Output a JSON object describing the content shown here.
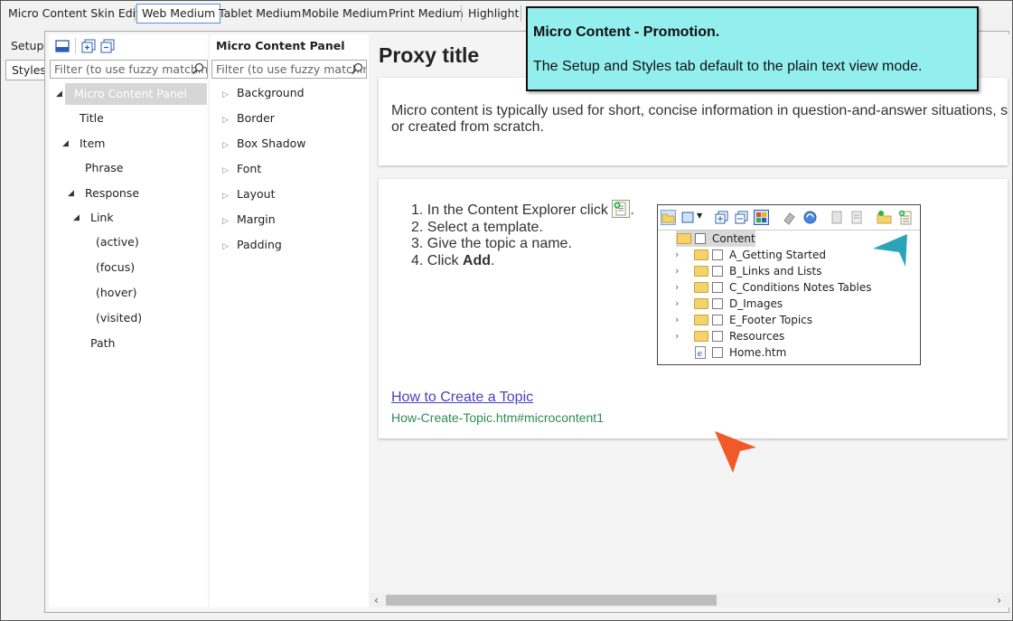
{
  "tabs": {
    "editor": "Micro Content Skin Editor",
    "web_medium": "Web Medium",
    "tablet_medium": "Tablet Medium",
    "mobile_medium": "Mobile Medium",
    "print_medium": "Print Medium",
    "highlight": "Highlight"
  },
  "side_tabs": {
    "setup": "Setup",
    "styles": "Styles"
  },
  "filter_placeholder": "Filter (to use fuzzy matching",
  "tree": {
    "root": "Micro Content Panel",
    "title": "Title",
    "item": "Item",
    "phrase": "Phrase",
    "response": "Response",
    "link": "Link",
    "active": "(active)",
    "focus": "(focus)",
    "hover": "(hover)",
    "visited": "(visited)",
    "path": "Path"
  },
  "properties": {
    "heading": "Micro Content Panel",
    "items": [
      "Background",
      "Border",
      "Box Shadow",
      "Font",
      "Layout",
      "Margin",
      "Padding"
    ]
  },
  "preview": {
    "proxy_title": "Proxy title",
    "intro_line1": "Micro content is typically used for short, concise information in question-and-answer situations, s",
    "intro_line2": "or created from scratch.",
    "steps": {
      "step1": "In the Content Explorer click",
      "step2": "Select a template.",
      "step3": "Give the topic a name.",
      "step4_prefix": "Click ",
      "step4_bold": "Add",
      "step4_suffix": "."
    },
    "link_text": "How to Create a Topic",
    "link_path": "How-Create-Topic.htm#microcontent1"
  },
  "explorer": {
    "root": "Content",
    "folders": [
      "A_Getting Started",
      "B_Links and Lists",
      "C_Conditions Notes Tables",
      "D_Images",
      "E_Footer Topics",
      "Resources"
    ],
    "file": "Home.htm"
  },
  "callout": {
    "title": "Micro Content - Promotion.",
    "text": "The Setup and Styles tab default to the plain text view mode."
  },
  "colors": {
    "callout_bg": "#93efee",
    "pointer_orange": "#f05a28",
    "pointer_teal": "#2aa5b8",
    "link": "#4b3fbf",
    "link_path": "#2e8b57"
  }
}
